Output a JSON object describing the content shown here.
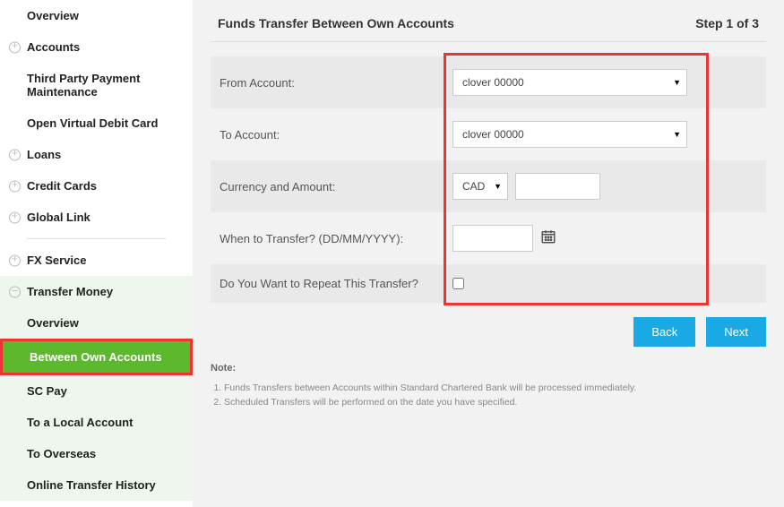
{
  "sidebar": {
    "items": [
      {
        "label": "Overview",
        "expand": null
      },
      {
        "label": "Accounts",
        "expand": "plus"
      },
      {
        "label": "Third Party Payment Maintenance",
        "expand": null
      },
      {
        "label": "Open Virtual Debit Card",
        "expand": null
      },
      {
        "label": "Loans",
        "expand": "plus"
      },
      {
        "label": "Credit Cards",
        "expand": "plus"
      },
      {
        "label": "Global Link",
        "expand": "plus"
      },
      {
        "label": "FX Service",
        "expand": "plus"
      }
    ],
    "transfer": {
      "label": "Transfer Money",
      "items": [
        "Overview",
        "Between Own Accounts",
        "SC Pay",
        "To a Local Account",
        "To Overseas",
        "Online Transfer History"
      ]
    }
  },
  "header": {
    "title": "Funds Transfer Between Own Accounts",
    "step": "Step 1 of 3"
  },
  "form": {
    "fromAccount": {
      "label": "From Account:",
      "value": "clover 00000"
    },
    "toAccount": {
      "label": "To Account:",
      "value": "clover 00000"
    },
    "currency": {
      "label": "Currency and Amount:",
      "selected": "CAD",
      "amount": ""
    },
    "when": {
      "label": "When to Transfer? (DD/MM/YYYY):",
      "value": ""
    },
    "repeat": {
      "label": "Do You Want to Repeat This Transfer?"
    }
  },
  "buttons": {
    "back": "Back",
    "next": "Next"
  },
  "notes": {
    "title": "Note:",
    "items": [
      "Funds Transfers between Accounts within Standard Chartered Bank will be processed immediately.",
      "Scheduled Transfers will be performed on the date you have specified."
    ]
  }
}
